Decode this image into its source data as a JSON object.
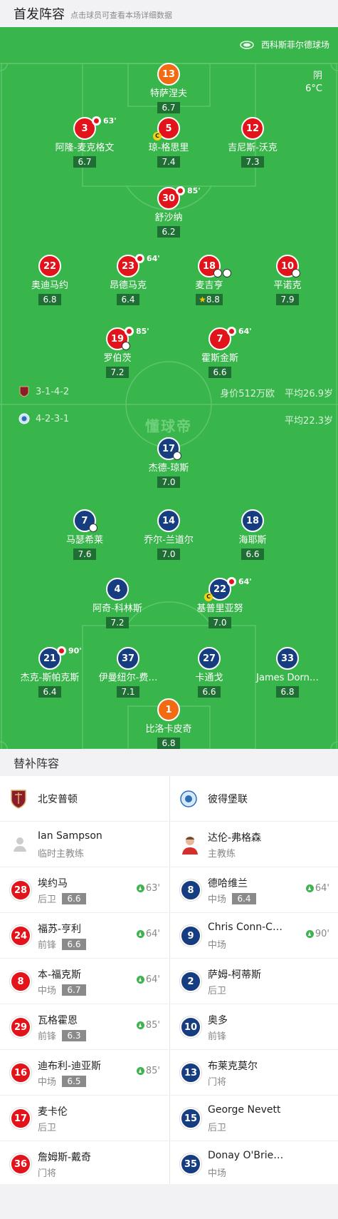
{
  "header": {
    "title": "首发阵容",
    "subtitle": "点击球员可查看本场详细数据"
  },
  "stadium": "西科斯菲尔德球场",
  "weather": {
    "condition": "阴",
    "temp": "6°C"
  },
  "home_info": {
    "formation": "3-1-4-2",
    "value": "身价512万欧",
    "avg_age": "平均26.9岁"
  },
  "away_info": {
    "formation": "4-2-3-1",
    "avg_age": "平均22.3岁"
  },
  "watermark": "懂球帝",
  "home_lineup": [
    {
      "num": "13",
      "name": "特萨涅夫",
      "rating": "6.7"
    },
    {
      "num": "3",
      "name": "阿隆-麦克格文",
      "rating": "6.7",
      "sub": "63'"
    },
    {
      "num": "5",
      "name": "琼-格思里",
      "rating": "7.4",
      "captain": "C"
    },
    {
      "num": "12",
      "name": "吉尼斯-沃克",
      "rating": "7.3"
    },
    {
      "num": "30",
      "name": "舒沙纳",
      "rating": "6.2",
      "sub": "85'"
    },
    {
      "num": "22",
      "name": "奥迪马约",
      "rating": "6.8"
    },
    {
      "num": "23",
      "name": "昂德马克",
      "rating": "6.4",
      "sub": "64'"
    },
    {
      "num": "18",
      "name": "麦吉亨",
      "rating": "8.8"
    },
    {
      "num": "10",
      "name": "平诺克",
      "rating": "7.9"
    },
    {
      "num": "19",
      "name": "罗伯茨",
      "rating": "7.2",
      "sub": "85'"
    },
    {
      "num": "7",
      "name": "霍斯金斯",
      "rating": "6.6",
      "sub": "64'"
    }
  ],
  "away_lineup": [
    {
      "num": "17",
      "name": "杰德-琼斯",
      "rating": "7.0"
    },
    {
      "num": "7",
      "name": "马瑟希莱",
      "rating": "7.6"
    },
    {
      "num": "14",
      "name": "乔尔-兰道尔",
      "rating": "7.0"
    },
    {
      "num": "18",
      "name": "海耶斯",
      "rating": "6.6"
    },
    {
      "num": "4",
      "name": "阿奇-科林斯",
      "rating": "7.2"
    },
    {
      "num": "22",
      "name": "基普里亚努",
      "rating": "7.0",
      "sub": "64'",
      "captain": "C"
    },
    {
      "num": "21",
      "name": "杰克-斯帕克斯",
      "rating": "6.4",
      "sub": "90'"
    },
    {
      "num": "37",
      "name": "伊曼纽尔-费…",
      "rating": "7.1"
    },
    {
      "num": "27",
      "name": "卡通戈",
      "rating": "6.6"
    },
    {
      "num": "33",
      "name": "James Dorn…",
      "rating": "6.8"
    },
    {
      "num": "1",
      "name": "比洛卡皮奇",
      "rating": "6.8"
    }
  ],
  "subs_title": "替补阵容",
  "home_bench": {
    "team": "北安普顿",
    "coach": {
      "name": "Ian Sampson",
      "role": "临时主教练"
    },
    "players": [
      {
        "num": "28",
        "name": "埃约马",
        "pos": "后卫",
        "rating": "6.6",
        "min": "63'"
      },
      {
        "num": "24",
        "name": "福苏-亨利",
        "pos": "前锋",
        "rating": "6.6",
        "min": "64'"
      },
      {
        "num": "8",
        "name": "本-福克斯",
        "pos": "中场",
        "rating": "6.7",
        "min": "64'"
      },
      {
        "num": "29",
        "name": "瓦格霍恩",
        "pos": "前锋",
        "rating": "6.3",
        "min": "85'"
      },
      {
        "num": "16",
        "name": "迪布利-迪亚斯",
        "pos": "中场",
        "rating": "6.5",
        "min": "85'"
      },
      {
        "num": "17",
        "name": "麦卡伦",
        "pos": "后卫"
      },
      {
        "num": "36",
        "name": "詹姆斯-戴奇",
        "pos": "门将"
      }
    ]
  },
  "away_bench": {
    "team": "彼得堡联",
    "coach": {
      "name": "达伦-弗格森",
      "role": "主教练"
    },
    "players": [
      {
        "num": "8",
        "name": "德哈维兰",
        "pos": "中场",
        "rating": "6.4",
        "min": "64'"
      },
      {
        "num": "9",
        "name": "Chris Conn-C…",
        "pos": "中场",
        "min": "90'"
      },
      {
        "num": "2",
        "name": "萨姆-柯蒂斯",
        "pos": "后卫"
      },
      {
        "num": "10",
        "name": "奥多",
        "pos": "前锋"
      },
      {
        "num": "13",
        "name": "布莱克莫尔",
        "pos": "门将"
      },
      {
        "num": "15",
        "name": "George Nevett",
        "pos": "后卫"
      },
      {
        "num": "35",
        "name": "Donay O'Brie…",
        "pos": "中场"
      }
    ]
  },
  "colors": {
    "pitch": "#39b64b",
    "home": "#e3131b",
    "away": "#163d80",
    "gk": "#f26b12"
  }
}
